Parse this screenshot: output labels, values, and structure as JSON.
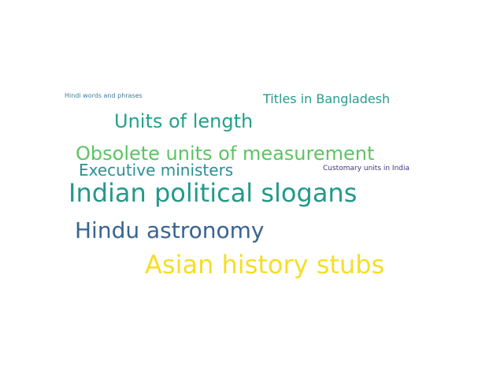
{
  "words": [
    {
      "text": "Hindi words and phrases",
      "color": "#3e7a98"
    },
    {
      "text": "Titles in Bangladesh",
      "color": "#2a9a8e"
    },
    {
      "text": "Units of length",
      "color": "#23a28a"
    },
    {
      "text": "Obsolete units of measurement",
      "color": "#5cc461"
    },
    {
      "text": "Executive ministers",
      "color": "#2a8f97"
    },
    {
      "text": "Customary units in India",
      "color": "#46327e"
    },
    {
      "text": "Indian political slogans",
      "color": "#22998a"
    },
    {
      "text": "Hindu astronomy",
      "color": "#3a6490"
    },
    {
      "text": "Asian history stubs",
      "color": "#f5de26"
    }
  ]
}
